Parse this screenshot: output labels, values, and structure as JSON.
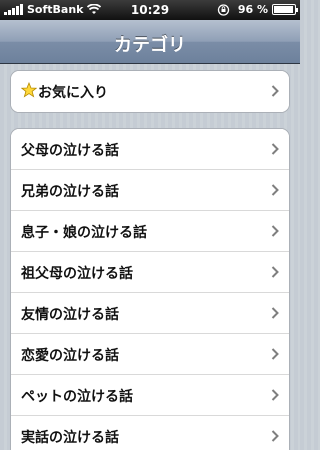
{
  "status_bar": {
    "carrier": "SoftBank",
    "time": "10:29",
    "battery_percent_text": "96 %",
    "battery_level": 0.96
  },
  "nav": {
    "title": "カテゴリ"
  },
  "favorites": {
    "label": "お気に入り",
    "icon": "star-icon"
  },
  "categories": [
    "父母の泣ける話",
    "兄弟の泣ける話",
    "息子・娘の泣ける話",
    "祖父母の泣ける話",
    "友情の泣ける話",
    "恋愛の泣ける話",
    "ペットの泣ける話",
    "実話の泣ける話"
  ]
}
